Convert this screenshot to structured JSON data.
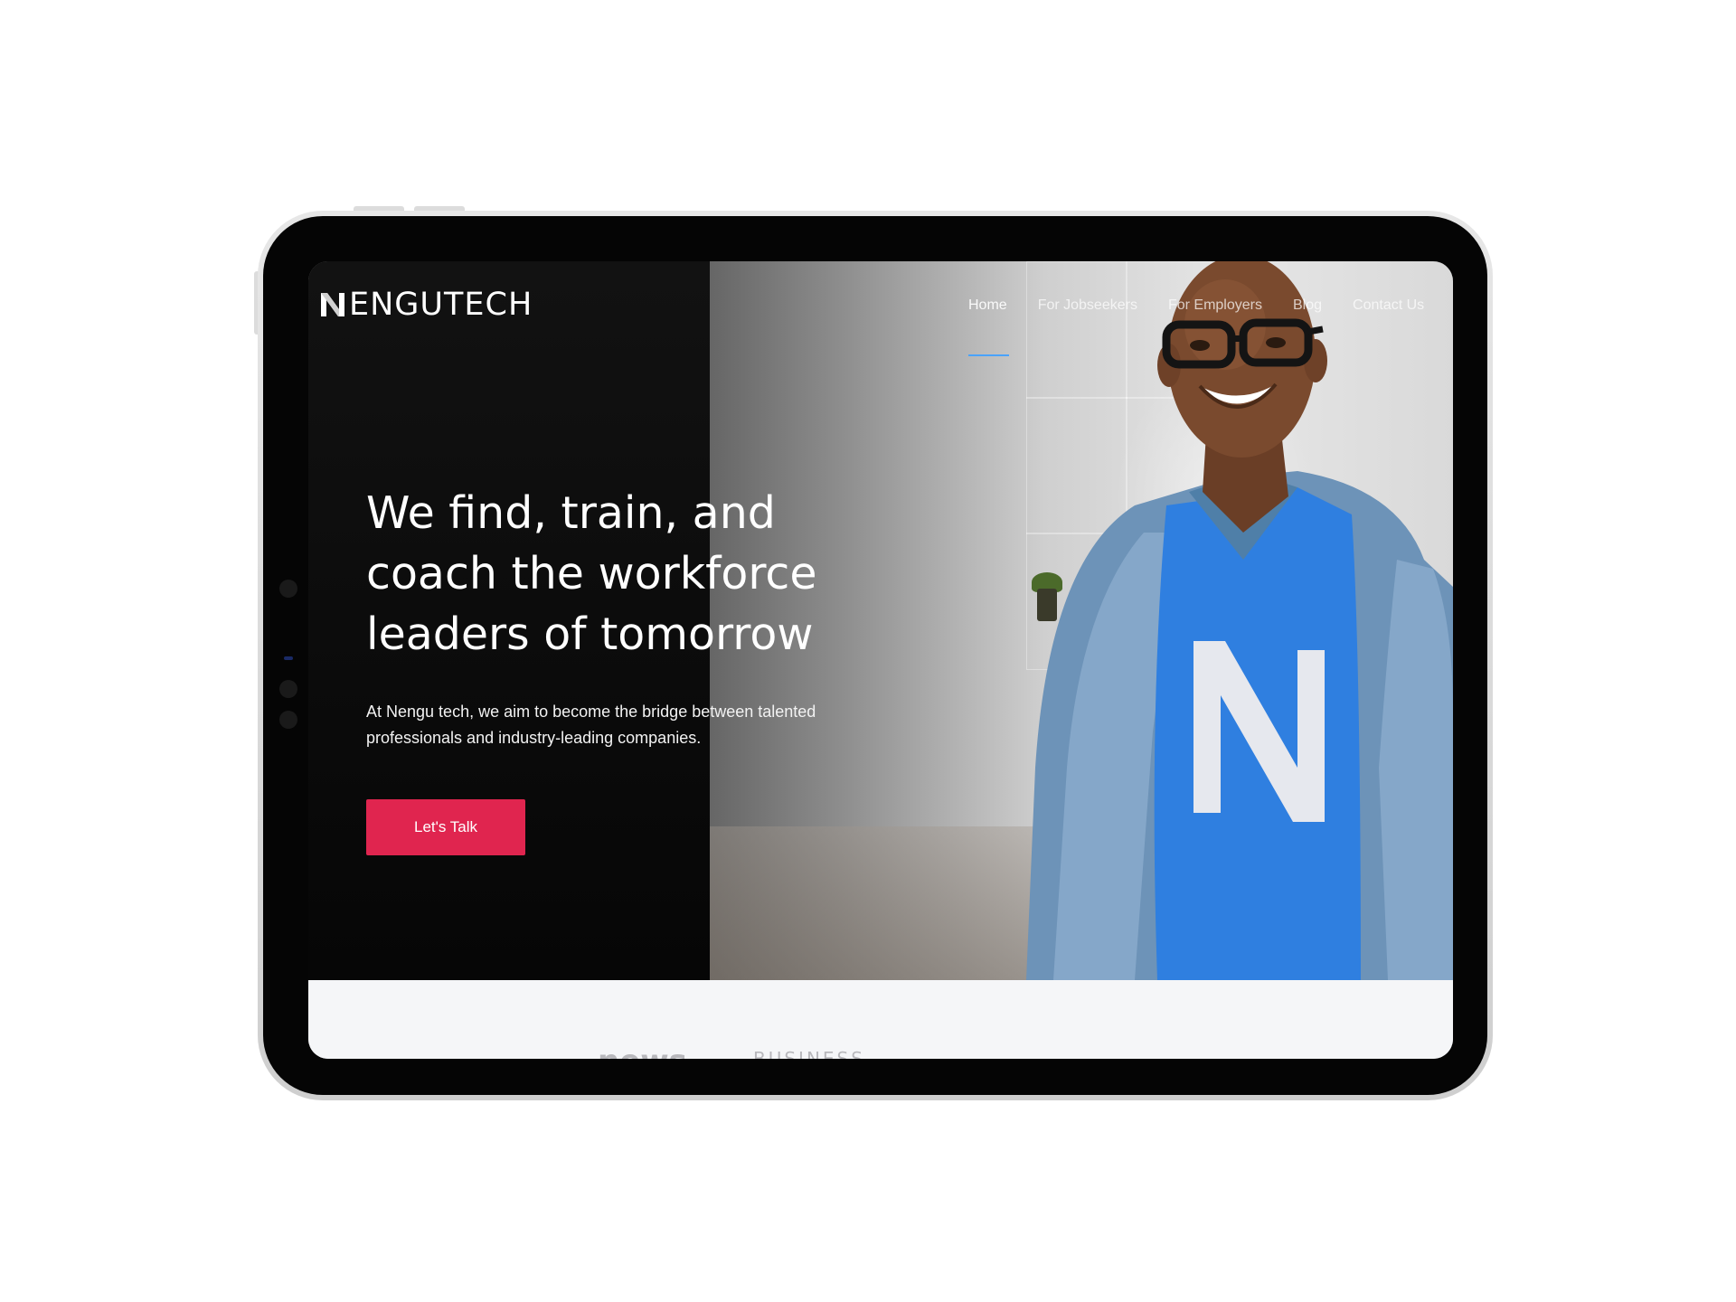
{
  "brand": {
    "name": "ENGUTECH",
    "mark": "N"
  },
  "nav": {
    "items": [
      {
        "label": "Home",
        "active": true
      },
      {
        "label": "For Jobseekers"
      },
      {
        "label": "For Employers"
      },
      {
        "label": "Blog"
      },
      {
        "label": "Contact Us"
      }
    ]
  },
  "hero": {
    "headline": "We find, train, and coach the workforce leaders of tomorrow",
    "subtext": "At Nengu tech, we aim to become the bridge between talented professionals and industry-leading companies.",
    "cta_label": "Let's Talk"
  },
  "partner_logos": [
    "news",
    "BUSINESS"
  ],
  "colors": {
    "cta": "#e0254f",
    "nav_active_underline": "#4aa3ff",
    "hero_background": "#070707",
    "shirt": "#2f7fe0"
  }
}
